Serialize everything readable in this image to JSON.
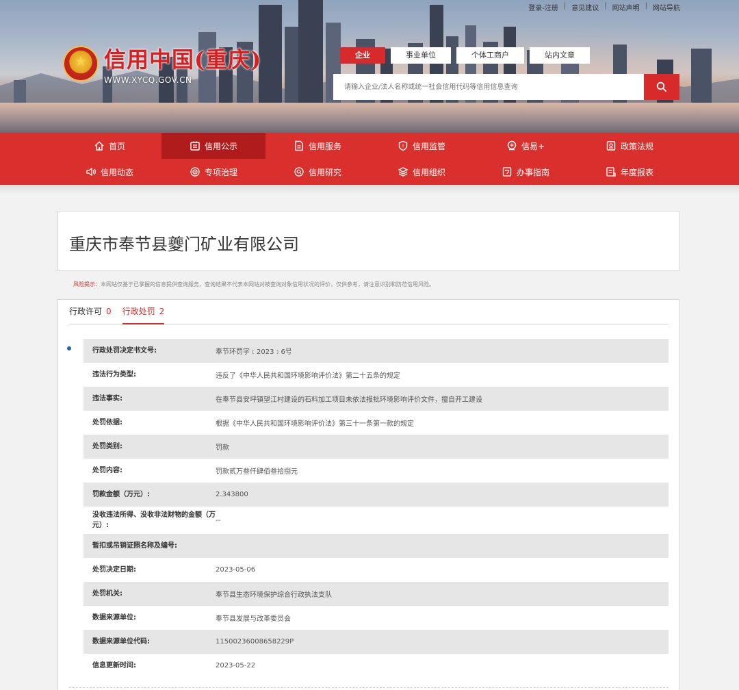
{
  "header": {
    "logo_title": "信用中国(重庆)",
    "logo_url": "WWW.XYCQ.GOV.CN",
    "top_links": [
      "登录-注册",
      "意见建议",
      "网站声明",
      "网站导航"
    ],
    "search_tabs": [
      "企业",
      "事业单位",
      "个体工商户",
      "站内文章"
    ],
    "search_placeholder": "请输入企业/法人名称或统一社会信用代码等信用信息查询"
  },
  "nav": {
    "row1": [
      {
        "label": "首页",
        "icon": "home-icon"
      },
      {
        "label": "信用公示",
        "icon": "announce-icon"
      },
      {
        "label": "信用服务",
        "icon": "document-icon"
      },
      {
        "label": "信用监管",
        "icon": "shield-icon"
      },
      {
        "label": "信易+",
        "icon": "yi-icon"
      },
      {
        "label": "政策法规",
        "icon": "policy-icon"
      }
    ],
    "row2": [
      {
        "label": "信用动态",
        "icon": "speaker-icon"
      },
      {
        "label": "专项治理",
        "icon": "target-icon"
      },
      {
        "label": "信用研究",
        "icon": "research-icon"
      },
      {
        "label": "信用组织",
        "icon": "layers-icon"
      },
      {
        "label": "办事指南",
        "icon": "guide-icon"
      },
      {
        "label": "年度报表",
        "icon": "report-icon"
      }
    ]
  },
  "company": {
    "name": "重庆市奉节县夔门矿业有限公司"
  },
  "risk": {
    "label": "风险提示：",
    "text": "本网站仅基于已掌握的信息提供查询服务，查询结果不代表本网站对被查询对象信用状况的评价，仅供参考，请注意识别和防范信用风险。"
  },
  "tabs": [
    {
      "label": "行政许可",
      "count": "0"
    },
    {
      "label": "行政处罚",
      "count": "2"
    }
  ],
  "penalty_rows": [
    {
      "key": "行政处罚决定书文号:",
      "value": "奉节环罚字﹝2023﹞6号"
    },
    {
      "key": "违法行为类型:",
      "value": "违反了《中华人民共和国环境影响评价法》第二十五条的规定"
    },
    {
      "key": "违法事实:",
      "value": "在奉节县安坪镇望江村建设的石料加工项目未依法报批环境影响评价文件，擅自开工建设"
    },
    {
      "key": "处罚依据:",
      "value": "根据《中华人民共和国环境影响评价法》第三十一条第一款的规定"
    },
    {
      "key": "处罚类别:",
      "value": "罚款"
    },
    {
      "key": "处罚内容:",
      "value": "罚款贰万叁仟肆佰叁拾捌元"
    },
    {
      "key": "罚款金额（万元）:",
      "value": "2.343800"
    },
    {
      "key": "没收违法所得、没收非法财物的金额（万元）:",
      "value": "--"
    },
    {
      "key": "暂扣或吊销证照名称及编号:",
      "value": ""
    },
    {
      "key": "处罚决定日期:",
      "value": "2023-05-06"
    },
    {
      "key": "处罚机关:",
      "value": "奉节县生态环境保护综合行政执法支队"
    },
    {
      "key": "数据来源单位:",
      "value": "奉节县发展与改革委员会"
    },
    {
      "key": "数据来源单位代码:",
      "value": "11500236008658229P"
    },
    {
      "key": "信息更新时间:",
      "value": "2023-05-22"
    }
  ]
}
